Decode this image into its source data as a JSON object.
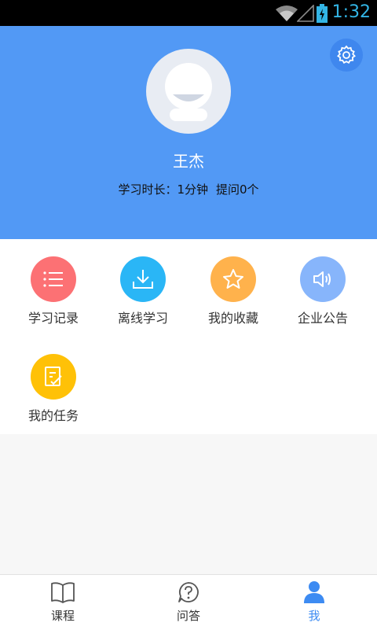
{
  "status_bar": {
    "time": "1:32",
    "icons": [
      "wifi-icon",
      "signal-icon",
      "battery-charging-icon"
    ]
  },
  "profile": {
    "username": "王杰",
    "study_time": "学习时长：1分钟",
    "questions": "提问0个",
    "header_color": "#5299f5"
  },
  "menu": {
    "items": [
      {
        "label": "学习记录",
        "icon": "list-icon",
        "color": "#fc7174"
      },
      {
        "label": "离线学习",
        "icon": "download-icon",
        "color": "#2ab6f6"
      },
      {
        "label": "我的收藏",
        "icon": "star-icon",
        "color": "#ffb24c"
      },
      {
        "label": "企业公告",
        "icon": "speaker-icon",
        "color": "#87b5fb"
      },
      {
        "label": "我的任务",
        "icon": "task-icon",
        "color": "#ffc107"
      }
    ]
  },
  "bottom_nav": {
    "items": [
      {
        "label": "课程",
        "icon": "book-icon"
      },
      {
        "label": "问答",
        "icon": "question-icon"
      },
      {
        "label": "我",
        "icon": "person-icon",
        "active": true
      }
    ],
    "active_color": "#3d8bf2"
  }
}
